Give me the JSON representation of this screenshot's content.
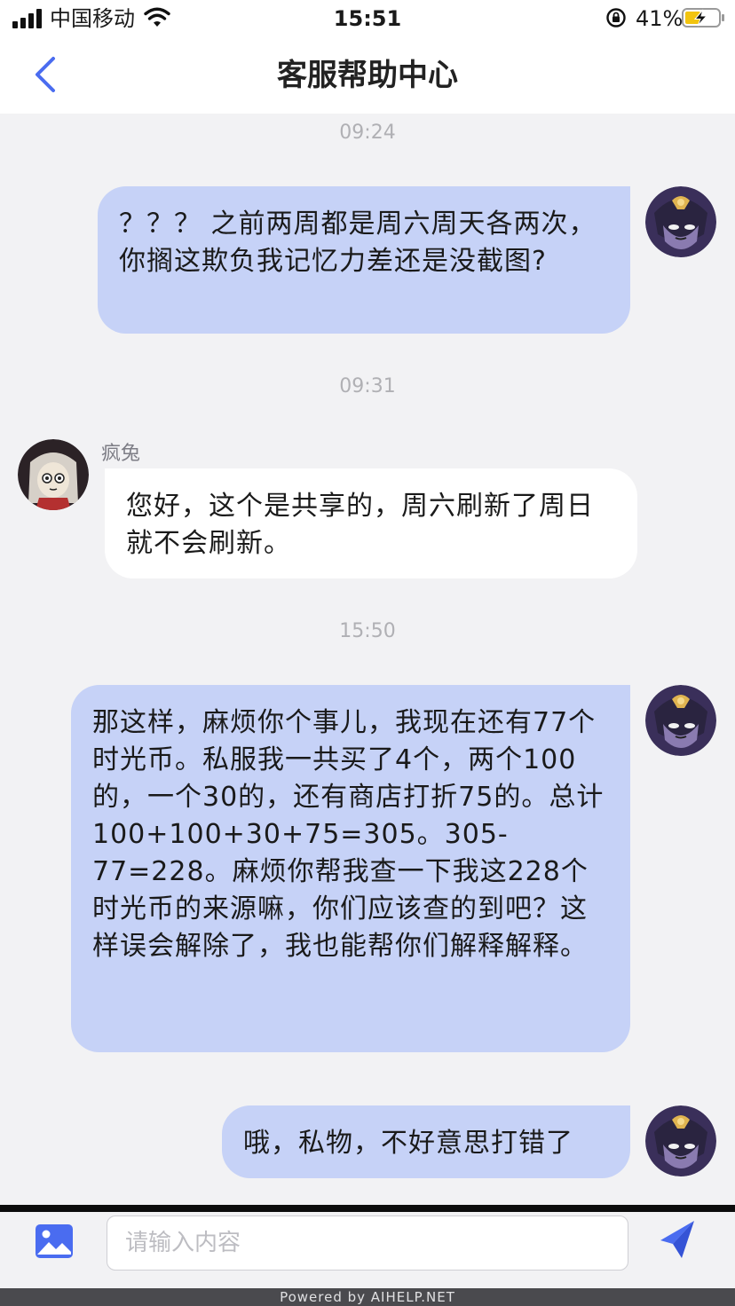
{
  "status_bar": {
    "carrier": "中国移动",
    "time": "15:51",
    "battery": "41%"
  },
  "nav": {
    "title": "客服帮助中心"
  },
  "messages": {
    "t1": "09:24",
    "m1": "？？？ 之前两周都是周六周天各两次，你搁这欺负我记忆力差还是没截图?",
    "t2": "09:31",
    "agent_name": "疯兔",
    "m2": "您好，这个是共享的，周六刷新了周日就不会刷新。",
    "t3": "15:50",
    "m3": "那这样，麻烦你个事儿，我现在还有77个时光币。私服我一共买了4个，两个100的，一个30的，还有商店打折75的。总计100+100+30+75=305。305-77=228。麻烦你帮我查一下我这228个时光币的来源嘛，你们应该查的到吧？这样误会解除了，我也能帮你们解释解释。",
    "m4": "哦，私物，不好意思打错了"
  },
  "input": {
    "placeholder": "请输入内容",
    "value": ""
  },
  "footer": {
    "text": "Powered by AIHELP.NET"
  },
  "colors": {
    "accent": "#4a6cf0",
    "user_bubble": "#c6d2f7",
    "agent_bubble": "#ffffff",
    "background": "#f2f2f4"
  }
}
